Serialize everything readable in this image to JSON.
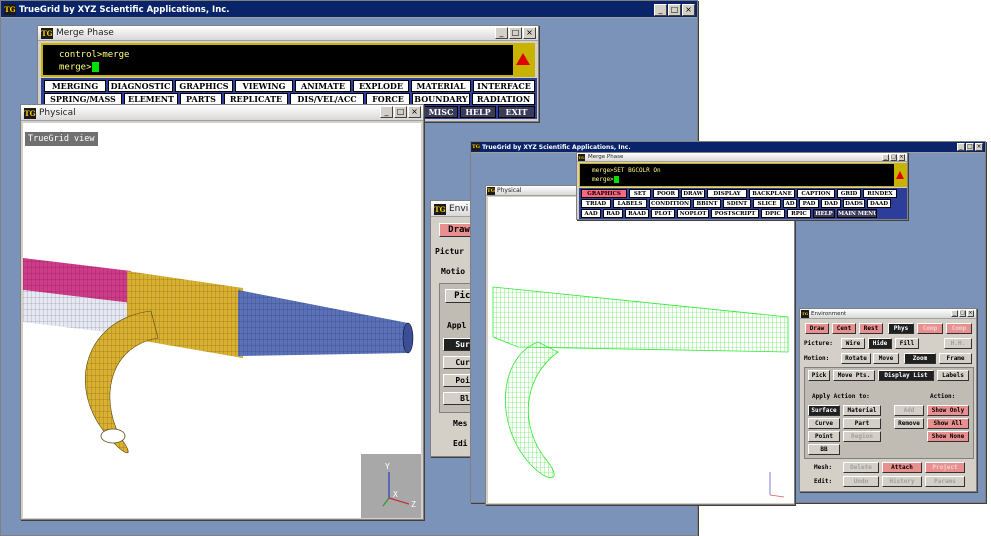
{
  "main_window": {
    "title": "TrueGrid by XYZ Scientific Applications, Inc."
  },
  "merge_window": {
    "title": "Merge Phase",
    "console_lines": [
      "control>merge",
      "merge>"
    ],
    "menu_row1": [
      "MERGING",
      "DIAGNOSTIC",
      "GRAPHICS",
      "VIEWING",
      "ANIMATE",
      "EXPLODE",
      "MATERIAL",
      "INTERFACE"
    ],
    "menu_row2": [
      "SPRING/MASS",
      "ELEMENT",
      "PARTS",
      "REPLICATE",
      "DIS/VEL/ACC",
      "FORCE",
      "BOUNDARY",
      "RADIATION"
    ],
    "menu_row3": [
      "MISC",
      "HELP",
      "EXIT"
    ]
  },
  "physical_window": {
    "title": "Physical",
    "view_label": "TrueGrid view",
    "axes": [
      "Y",
      "X",
      "Z"
    ]
  },
  "env_window_partial": {
    "title": "Envi",
    "buttons": [
      "Draw",
      "Pick",
      "Surf",
      "Curv",
      "Poin",
      "Bl"
    ],
    "labels": [
      "Pictur",
      "Motio",
      "Appl",
      "Mes",
      "Edi"
    ]
  },
  "second_main": {
    "title": "TrueGrid by XYZ Scientific Applications, Inc."
  },
  "second_merge": {
    "title": "Merge Phase",
    "console_lines": [
      "merge>SET BGCOLR On",
      "merge>"
    ],
    "menu_row1": [
      "GRAPHICS",
      "SET",
      "POOR",
      "DRAW",
      "DISPLAY",
      "BACKPLANE",
      "CAPTION",
      "GRID",
      "RINDEX"
    ],
    "menu_row2": [
      "TRIAD",
      "LABELS",
      "CONDITION",
      "BBINT",
      "SDINT",
      "SLICE",
      "AD",
      "PAD",
      "DAD",
      "DADS",
      "DAAD"
    ],
    "menu_row3": [
      "AAD",
      "RAD",
      "RAAD",
      "PLOT",
      "NOPLOT",
      "POSTSCRIPT",
      "DPIC",
      "RPIC",
      "HELP",
      "MAIN MENU"
    ]
  },
  "second_physical": {
    "title": "Physical"
  },
  "environment": {
    "title": "Environment",
    "row1": [
      "Draw",
      "Cent",
      "Rest",
      "Phys",
      "Comp",
      "Comp"
    ],
    "picture_label": "Picture:",
    "picture": [
      "Wire",
      "Hide",
      "Fill",
      "H.H."
    ],
    "motion_label": "Motion:",
    "motion": [
      "Rotate",
      "Move",
      "Zoom",
      "Frame"
    ],
    "tabs": [
      "Pick",
      "Move Pts.",
      "Display List",
      "Labels"
    ],
    "apply_label": "Apply Action to:",
    "action_label": "Action:",
    "apply": [
      "Surface",
      "Material",
      "Curve",
      "Part",
      "Point",
      "Region",
      "BB"
    ],
    "action_mid": [
      "Add",
      "Remove"
    ],
    "action": [
      "Show Only",
      "Show All",
      "Show None"
    ],
    "mesh_label": "Mesh:",
    "mesh": [
      "Delete",
      "Attach",
      "Project"
    ],
    "edit_label": "Edit:",
    "edit": [
      "Undo",
      "History",
      "Params"
    ]
  },
  "colors": {
    "desktop": "#7b93b8",
    "mesh_green": "#30e830",
    "mesh_gold": "#d9b030",
    "mesh_blue": "#5a70b8",
    "mesh_pink": "#d03a8a"
  }
}
